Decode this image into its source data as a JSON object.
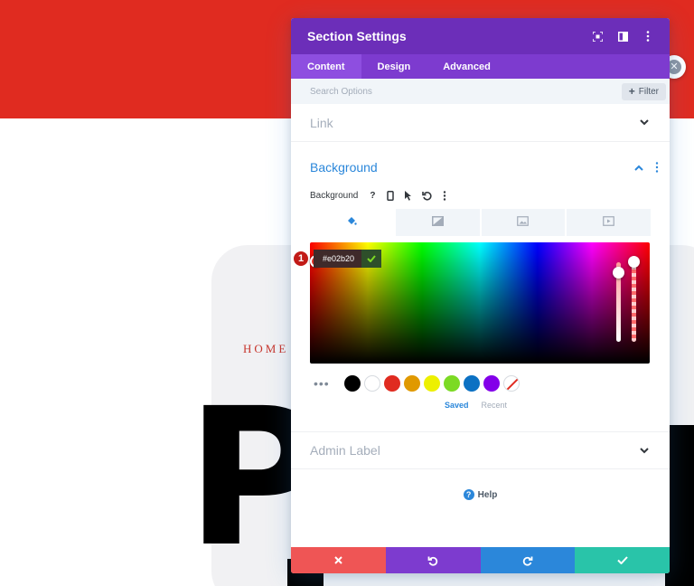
{
  "colors": {
    "page_red": "#e02b20",
    "modal_header": "#6c2eb9",
    "tabs_bar": "#7d3bcf",
    "accent_blue": "#2b87da",
    "cancel": "#ef5555",
    "save": "#29c4a9"
  },
  "background_page": {
    "home_label": "HOME",
    "big_letter": "P"
  },
  "modal": {
    "title": "Section Settings",
    "header_icons": [
      "fullscreen-icon",
      "split-view-icon",
      "more-vertical-icon"
    ],
    "tabs": [
      {
        "label": "Content",
        "active": true
      },
      {
        "label": "Design",
        "active": false
      },
      {
        "label": "Advanced",
        "active": false
      }
    ],
    "search": {
      "placeholder": "Search Options"
    },
    "filter_label": "Filter",
    "link_toggle": "Link",
    "background": {
      "title": "Background",
      "field_label": "Background",
      "field_icons": [
        "help-icon",
        "mobile-icon",
        "cursor-icon",
        "reset-icon",
        "more-vertical-icon"
      ],
      "type_tabs": [
        "color-fill-icon",
        "gradient-icon",
        "image-icon",
        "video-icon"
      ],
      "hex_value": "#e02b20",
      "step_badge": "1",
      "swatches": [
        "#000000",
        "#ffffff",
        "#e02b20",
        "#e09900",
        "#edf000",
        "#7cda24",
        "#0c71c3",
        "#8300e9"
      ],
      "saved_label": "Saved",
      "recent_label": "Recent"
    },
    "admin_label": "Admin Label",
    "help_label": "Help"
  }
}
